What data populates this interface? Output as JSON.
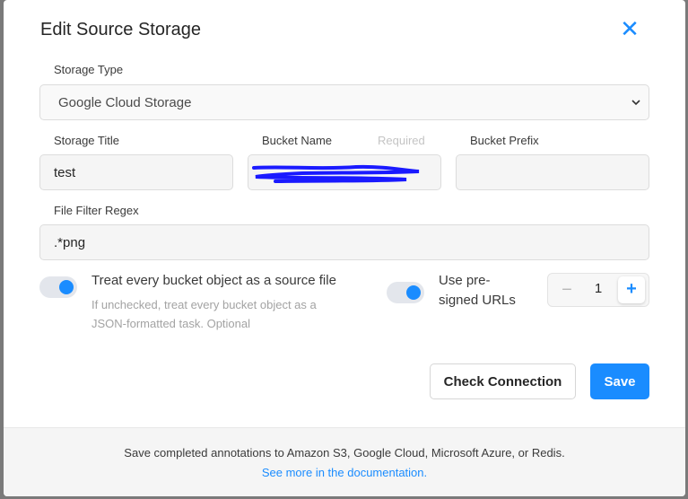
{
  "dialog": {
    "title": "Edit Source Storage",
    "close_glyph": "✕"
  },
  "storage_type": {
    "label": "Storage Type",
    "selected": "Google Cloud Storage"
  },
  "storage_title": {
    "label": "Storage Title",
    "value": "test"
  },
  "bucket_name": {
    "label": "Bucket Name",
    "required_hint": "Required",
    "value_redacted": true
  },
  "bucket_prefix": {
    "label": "Bucket Prefix",
    "value": ""
  },
  "file_filter": {
    "label": "File Filter Regex",
    "value": ".*png"
  },
  "treat_as_source": {
    "label": "Treat every bucket object as a source file",
    "help": "If unchecked, treat every bucket object as a JSON-formatted task. Optional",
    "enabled": true
  },
  "presigned": {
    "label": "Use pre-signed URLs",
    "enabled": true
  },
  "stepper": {
    "minus": "−",
    "value": "1",
    "plus": "+"
  },
  "buttons": {
    "check_connection": "Check Connection",
    "save": "Save"
  },
  "footer": {
    "text": "Save completed annotations to Amazon S3, Google Cloud, Microsoft Azure, or Redis.",
    "link": "See more in the documentation",
    "link_suffix": "."
  },
  "colors": {
    "accent": "#1a8cff",
    "redaction": "#1a1aff"
  }
}
